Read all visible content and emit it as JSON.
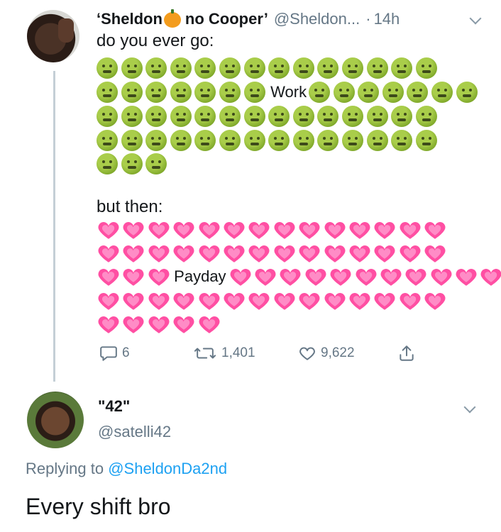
{
  "tweet": {
    "display_name_a": "‘Sheldon",
    "display_name_b": "no Cooper’",
    "handle": "@Sheldon...",
    "dot": "·",
    "time": "14h",
    "intro_text": "do you ever go:",
    "work_label": "Work",
    "then_text": "but then:",
    "payday_label": "Payday",
    "actions": {
      "replies": "6",
      "retweets": "1,401",
      "likes": "9,622"
    },
    "emoji_counts": {
      "sick_rows": [
        14,
        14,
        14,
        14,
        3
      ],
      "heart_rows": [
        14,
        14,
        14,
        14,
        5
      ]
    },
    "colors": {
      "sick_face": "#8db43a",
      "heart_pink": "#ff4fa3",
      "link_blue": "#1da1f2",
      "muted_gray": "#657786"
    }
  },
  "reply": {
    "display_name": "\"42\"",
    "handle": "@satelli42",
    "replying_prefix": "Replying to",
    "replying_to": "@SheldonDa2nd",
    "text": "Every shift bro"
  },
  "icons": {
    "reply": "speech-bubble-icon",
    "retweet": "retweet-icon",
    "like": "heart-outline-icon",
    "share": "share-icon",
    "menu": "chevron-down-icon"
  }
}
